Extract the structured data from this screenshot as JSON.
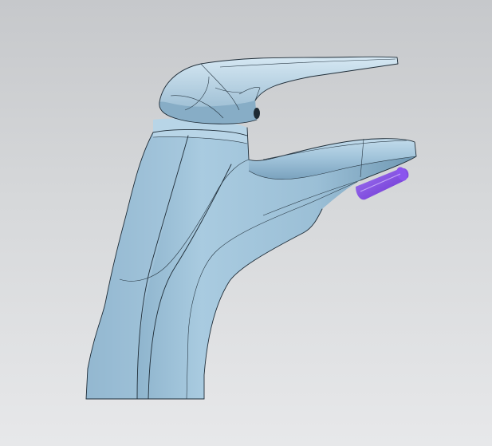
{
  "viewport": {
    "background_top": "#c6c8cb",
    "background_bottom": "#e7e8ea"
  },
  "model": {
    "body_color": "#9cbfd6",
    "highlight_color": "#cfe3f0",
    "shadow_color": "#6f98b3",
    "edge_color": "#1f2d38",
    "aerator_color": "#7b3fe0",
    "aerator_highlight": "#a077f2"
  }
}
